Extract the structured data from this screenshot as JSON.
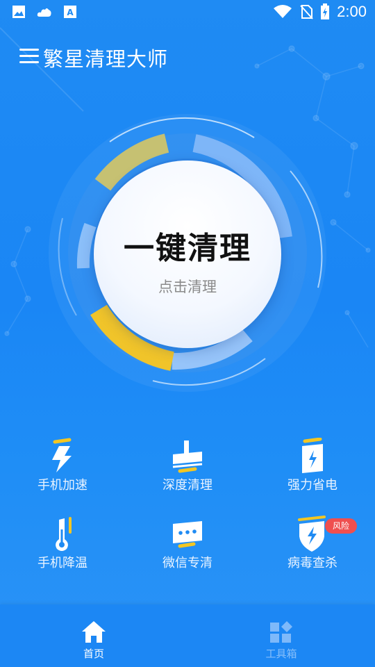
{
  "status_bar": {
    "time": "2:00",
    "left_icons": [
      "image-icon",
      "cloud-icon",
      "translate-icon"
    ],
    "right_icons": [
      "wifi-icon",
      "no-sim-icon",
      "battery-charging-icon"
    ]
  },
  "header": {
    "menu_icon": "hamburger-menu-icon",
    "title": "繁星清理大师"
  },
  "cleaner": {
    "main_label": "一键清理",
    "sub_label": "点击清理",
    "colors": {
      "ring_yellow": "#e8c43a",
      "ring_light": "#c8dcff",
      "core": "#ffffff"
    }
  },
  "features": [
    {
      "label": "手机加速",
      "icon": "lightning-icon"
    },
    {
      "label": "深度清理",
      "icon": "broom-icon"
    },
    {
      "label": "强力省电",
      "icon": "battery-icon"
    },
    {
      "label": "手机降温",
      "icon": "thermometer-icon"
    },
    {
      "label": "微信专清",
      "icon": "chat-icon"
    },
    {
      "label": "病毒查杀",
      "icon": "shield-icon",
      "badge": "风险"
    }
  ],
  "bottom_nav": {
    "tabs": [
      {
        "label": "首页",
        "icon": "home-icon",
        "active": true
      },
      {
        "label": "工具箱",
        "icon": "toolbox-icon",
        "active": false
      }
    ]
  },
  "colors": {
    "background": "#1a86f5",
    "accent_yellow": "#f3c623",
    "badge": "#ef4f4f"
  }
}
